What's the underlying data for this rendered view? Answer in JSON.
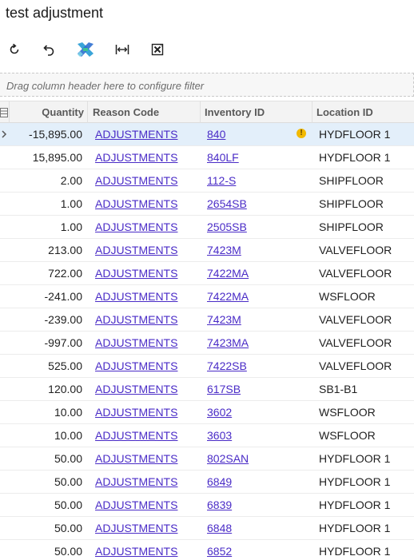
{
  "page": {
    "title": "test adjustment"
  },
  "toolbar": {
    "buttons": [
      {
        "icon": "refresh-icon"
      },
      {
        "icon": "undo-icon"
      },
      {
        "icon": "acumatica-logo-icon"
      },
      {
        "icon": "fit-columns-icon"
      },
      {
        "icon": "excel-export-icon"
      }
    ]
  },
  "filter": {
    "placeholder": "Drag column header here to configure filter"
  },
  "grid": {
    "columns": {
      "quantity": "Quantity",
      "reason_code": "Reason Code",
      "inventory_id": "Inventory ID",
      "location_id": "Location ID"
    },
    "rows": [
      {
        "quantity": "-15,895.00",
        "reason_code": "ADJUSTMENTS",
        "inventory_id": "840",
        "location_id": "HYDFLOOR 1"
      },
      {
        "quantity": "15,895.00",
        "reason_code": "ADJUSTMENTS",
        "inventory_id": "840LF",
        "location_id": "HYDFLOOR 1"
      },
      {
        "quantity": "2.00",
        "reason_code": "ADJUSTMENTS",
        "inventory_id": "112-S",
        "location_id": "SHIPFLOOR"
      },
      {
        "quantity": "1.00",
        "reason_code": "ADJUSTMENTS",
        "inventory_id": "2654SB",
        "location_id": "SHIPFLOOR"
      },
      {
        "quantity": "1.00",
        "reason_code": "ADJUSTMENTS",
        "inventory_id": "2505SB",
        "location_id": "SHIPFLOOR"
      },
      {
        "quantity": "213.00",
        "reason_code": "ADJUSTMENTS",
        "inventory_id": "7423M",
        "location_id": "VALVEFLOOR"
      },
      {
        "quantity": "722.00",
        "reason_code": "ADJUSTMENTS",
        "inventory_id": "7422MA",
        "location_id": "VALVEFLOOR"
      },
      {
        "quantity": "-241.00",
        "reason_code": "ADJUSTMENTS",
        "inventory_id": "7422MA",
        "location_id": "WSFLOOR"
      },
      {
        "quantity": "-239.00",
        "reason_code": "ADJUSTMENTS",
        "inventory_id": "7423M",
        "location_id": "VALVEFLOOR"
      },
      {
        "quantity": "-997.00",
        "reason_code": "ADJUSTMENTS",
        "inventory_id": "7423MA",
        "location_id": "VALVEFLOOR"
      },
      {
        "quantity": "525.00",
        "reason_code": "ADJUSTMENTS",
        "inventory_id": "7422SB",
        "location_id": "VALVEFLOOR"
      },
      {
        "quantity": "120.00",
        "reason_code": "ADJUSTMENTS",
        "inventory_id": "617SB",
        "location_id": "SB1-B1"
      },
      {
        "quantity": "10.00",
        "reason_code": "ADJUSTMENTS",
        "inventory_id": "3602",
        "location_id": "WSFLOOR"
      },
      {
        "quantity": "10.00",
        "reason_code": "ADJUSTMENTS",
        "inventory_id": "3603",
        "location_id": "WSFLOOR"
      },
      {
        "quantity": "50.00",
        "reason_code": "ADJUSTMENTS",
        "inventory_id": "802SAN",
        "location_id": "HYDFLOOR 1"
      },
      {
        "quantity": "50.00",
        "reason_code": "ADJUSTMENTS",
        "inventory_id": "6849",
        "location_id": "HYDFLOOR 1"
      },
      {
        "quantity": "50.00",
        "reason_code": "ADJUSTMENTS",
        "inventory_id": "6839",
        "location_id": "HYDFLOOR 1"
      },
      {
        "quantity": "50.00",
        "reason_code": "ADJUSTMENTS",
        "inventory_id": "6848",
        "location_id": "HYDFLOOR 1"
      },
      {
        "quantity": "50.00",
        "reason_code": "ADJUSTMENTS",
        "inventory_id": "6852",
        "location_id": "HYDFLOOR 1"
      }
    ],
    "selected_row": 0,
    "warning_row": 0
  },
  "colors": {
    "link": "#4a2cc7",
    "selected_row": "#e3effa",
    "warning": "#f2b900"
  }
}
